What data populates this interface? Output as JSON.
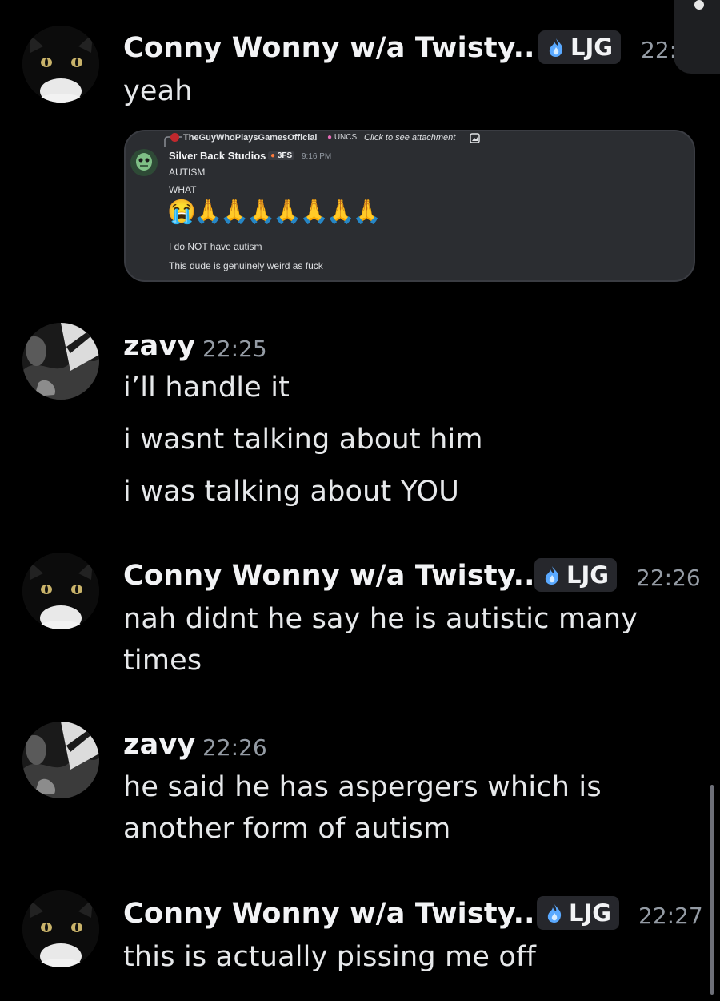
{
  "messages": [
    {
      "author": "Conny Wonny w/a Twisty...",
      "tag": "LJG",
      "time": "22:",
      "lines": [
        "yeah"
      ]
    },
    {
      "author": "zavy",
      "time": "22:25",
      "lines": [
        "i’ll handle it",
        "i wasnt talking about him",
        "i was talking about YOU"
      ]
    },
    {
      "author": "Conny Wonny w/a Twisty...",
      "tag": "LJG",
      "time": "22:26",
      "lines": [
        "nah didnt he say he is autistic many",
        "times"
      ]
    },
    {
      "author": "zavy",
      "time": "22:26",
      "lines": [
        "he said he has aspergers which is",
        "another form of autism"
      ]
    },
    {
      "author": "Conny Wonny w/a Twisty...",
      "tag": "LJG",
      "time": "22:27",
      "lines": [
        "this is actually pissing me off"
      ]
    }
  ],
  "embed": {
    "reply_author": "TheGuyWhoPlaysGamesOfficial",
    "reply_tag": "UNCS",
    "reply_hint": "Click to see attachment",
    "author": "Silver Back Studios",
    "author_tag": "3FS",
    "time": "9:16 PM",
    "lines": [
      "AUTISM",
      "WHAT"
    ],
    "emoji": "😭🙏🙏🙏🙏🙏🙏🙏",
    "lines_after": [
      "I do NOT have autism",
      "This dude is genuinely weird as fuck"
    ]
  },
  "colors": {
    "background": "#000000",
    "tag_background": "#26272c",
    "timestamp": "#949ba4",
    "embed_background": "#2b2d31"
  },
  "icons": [
    "fire-tag-icon",
    "attachment-image-icon",
    "cat-avatar",
    "bw-avatar"
  ]
}
